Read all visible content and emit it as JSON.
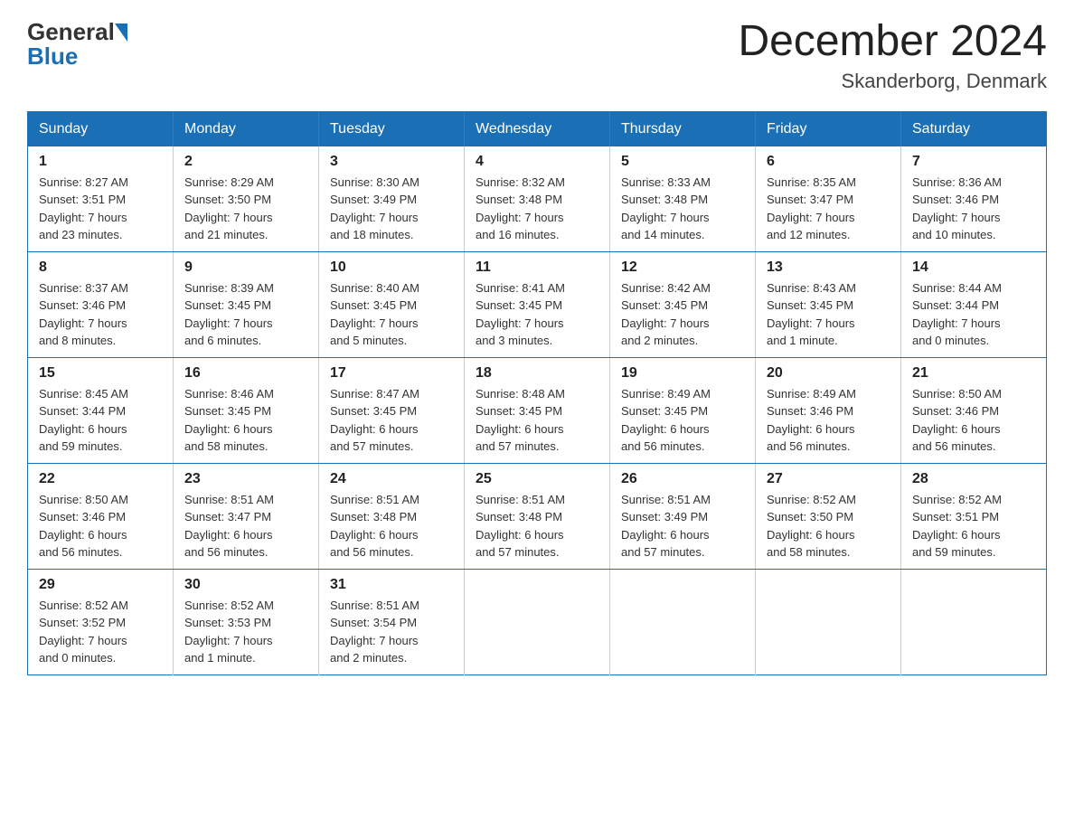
{
  "header": {
    "logo_general": "General",
    "logo_blue": "Blue",
    "month_title": "December 2024",
    "location": "Skanderborg, Denmark"
  },
  "days_of_week": [
    "Sunday",
    "Monday",
    "Tuesday",
    "Wednesday",
    "Thursday",
    "Friday",
    "Saturday"
  ],
  "weeks": [
    [
      {
        "day": "1",
        "sunrise": "8:27 AM",
        "sunset": "3:51 PM",
        "daylight_hours": "7",
        "daylight_minutes": "23"
      },
      {
        "day": "2",
        "sunrise": "8:29 AM",
        "sunset": "3:50 PM",
        "daylight_hours": "7",
        "daylight_minutes": "21"
      },
      {
        "day": "3",
        "sunrise": "8:30 AM",
        "sunset": "3:49 PM",
        "daylight_hours": "7",
        "daylight_minutes": "18"
      },
      {
        "day": "4",
        "sunrise": "8:32 AM",
        "sunset": "3:48 PM",
        "daylight_hours": "7",
        "daylight_minutes": "16"
      },
      {
        "day": "5",
        "sunrise": "8:33 AM",
        "sunset": "3:48 PM",
        "daylight_hours": "7",
        "daylight_minutes": "14"
      },
      {
        "day": "6",
        "sunrise": "8:35 AM",
        "sunset": "3:47 PM",
        "daylight_hours": "7",
        "daylight_minutes": "12"
      },
      {
        "day": "7",
        "sunrise": "8:36 AM",
        "sunset": "3:46 PM",
        "daylight_hours": "7",
        "daylight_minutes": "10"
      }
    ],
    [
      {
        "day": "8",
        "sunrise": "8:37 AM",
        "sunset": "3:46 PM",
        "daylight_hours": "7",
        "daylight_minutes": "8"
      },
      {
        "day": "9",
        "sunrise": "8:39 AM",
        "sunset": "3:45 PM",
        "daylight_hours": "7",
        "daylight_minutes": "6"
      },
      {
        "day": "10",
        "sunrise": "8:40 AM",
        "sunset": "3:45 PM",
        "daylight_hours": "7",
        "daylight_minutes": "5"
      },
      {
        "day": "11",
        "sunrise": "8:41 AM",
        "sunset": "3:45 PM",
        "daylight_hours": "7",
        "daylight_minutes": "3"
      },
      {
        "day": "12",
        "sunrise": "8:42 AM",
        "sunset": "3:45 PM",
        "daylight_hours": "7",
        "daylight_minutes": "2"
      },
      {
        "day": "13",
        "sunrise": "8:43 AM",
        "sunset": "3:45 PM",
        "daylight_hours": "7",
        "daylight_minutes": "1"
      },
      {
        "day": "14",
        "sunrise": "8:44 AM",
        "sunset": "3:44 PM",
        "daylight_hours": "7",
        "daylight_minutes": "0"
      }
    ],
    [
      {
        "day": "15",
        "sunrise": "8:45 AM",
        "sunset": "3:44 PM",
        "daylight_hours": "6",
        "daylight_minutes": "59"
      },
      {
        "day": "16",
        "sunrise": "8:46 AM",
        "sunset": "3:45 PM",
        "daylight_hours": "6",
        "daylight_minutes": "58"
      },
      {
        "day": "17",
        "sunrise": "8:47 AM",
        "sunset": "3:45 PM",
        "daylight_hours": "6",
        "daylight_minutes": "57"
      },
      {
        "day": "18",
        "sunrise": "8:48 AM",
        "sunset": "3:45 PM",
        "daylight_hours": "6",
        "daylight_minutes": "57"
      },
      {
        "day": "19",
        "sunrise": "8:49 AM",
        "sunset": "3:45 PM",
        "daylight_hours": "6",
        "daylight_minutes": "56"
      },
      {
        "day": "20",
        "sunrise": "8:49 AM",
        "sunset": "3:46 PM",
        "daylight_hours": "6",
        "daylight_minutes": "56"
      },
      {
        "day": "21",
        "sunrise": "8:50 AM",
        "sunset": "3:46 PM",
        "daylight_hours": "6",
        "daylight_minutes": "56"
      }
    ],
    [
      {
        "day": "22",
        "sunrise": "8:50 AM",
        "sunset": "3:46 PM",
        "daylight_hours": "6",
        "daylight_minutes": "56"
      },
      {
        "day": "23",
        "sunrise": "8:51 AM",
        "sunset": "3:47 PM",
        "daylight_hours": "6",
        "daylight_minutes": "56"
      },
      {
        "day": "24",
        "sunrise": "8:51 AM",
        "sunset": "3:48 PM",
        "daylight_hours": "6",
        "daylight_minutes": "56"
      },
      {
        "day": "25",
        "sunrise": "8:51 AM",
        "sunset": "3:48 PM",
        "daylight_hours": "6",
        "daylight_minutes": "57"
      },
      {
        "day": "26",
        "sunrise": "8:51 AM",
        "sunset": "3:49 PM",
        "daylight_hours": "6",
        "daylight_minutes": "57"
      },
      {
        "day": "27",
        "sunrise": "8:52 AM",
        "sunset": "3:50 PM",
        "daylight_hours": "6",
        "daylight_minutes": "58"
      },
      {
        "day": "28",
        "sunrise": "8:52 AM",
        "sunset": "3:51 PM",
        "daylight_hours": "6",
        "daylight_minutes": "59"
      }
    ],
    [
      {
        "day": "29",
        "sunrise": "8:52 AM",
        "sunset": "3:52 PM",
        "daylight_hours": "7",
        "daylight_minutes": "0"
      },
      {
        "day": "30",
        "sunrise": "8:52 AM",
        "sunset": "3:53 PM",
        "daylight_hours": "7",
        "daylight_minutes": "1"
      },
      {
        "day": "31",
        "sunrise": "8:51 AM",
        "sunset": "3:54 PM",
        "daylight_hours": "7",
        "daylight_minutes": "2"
      },
      null,
      null,
      null,
      null
    ]
  ],
  "labels": {
    "sunrise": "Sunrise:",
    "sunset": "Sunset:",
    "daylight": "Daylight:",
    "hours": "hours",
    "and": "and",
    "minutes": "minutes.",
    "minute": "minute."
  }
}
